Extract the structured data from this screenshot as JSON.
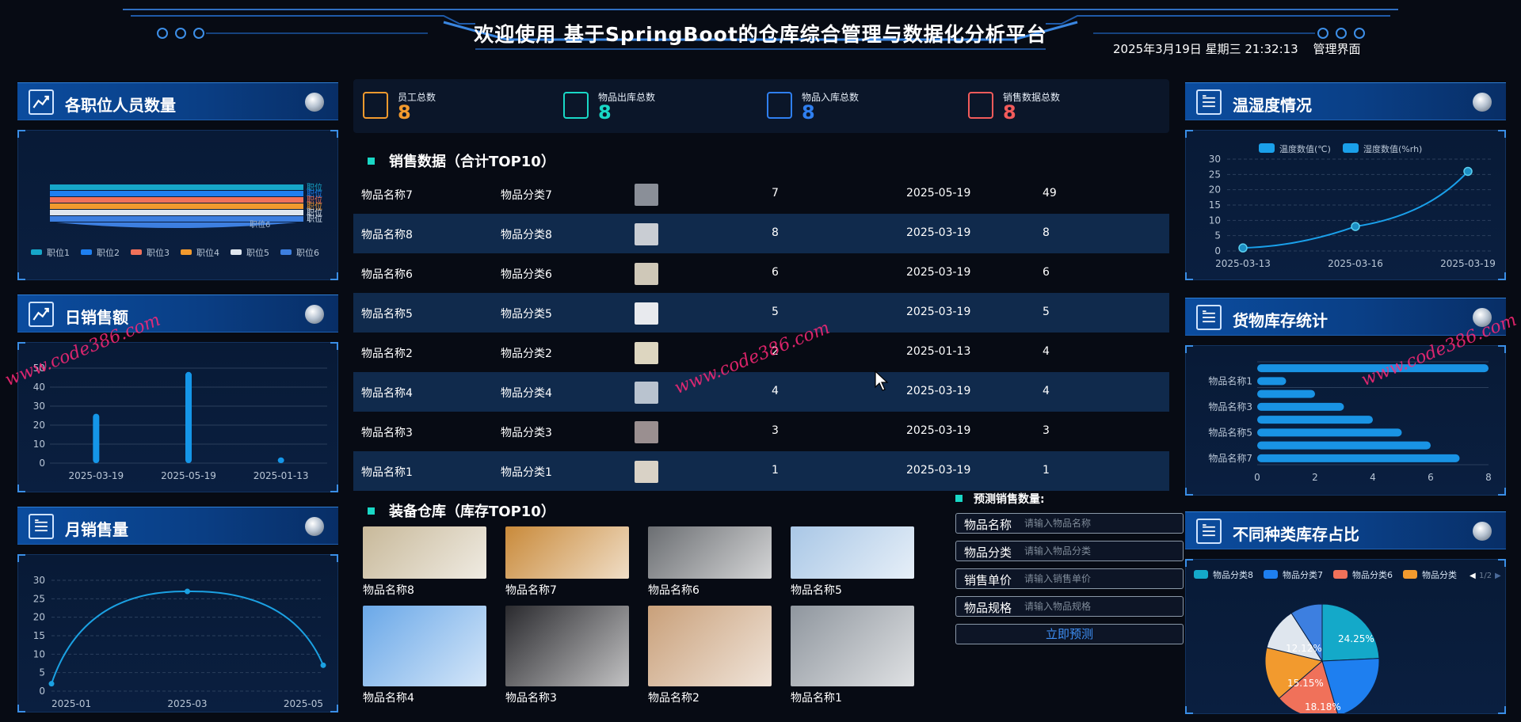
{
  "header": {
    "title": "欢迎使用 基于SpringBoot的仓库综合管理与数据化分析平台",
    "datetime": "2025年3月19日 星期三 21:32:13",
    "mode": "管理界面"
  },
  "colors": {
    "accent": "#1e8ff0",
    "teal": "#19d8c6",
    "orange": "#f29a2e",
    "red": "#f25b5b"
  },
  "left_panels": {
    "positions": {
      "title": "各职位人员数量",
      "icon": "trend-chart-icon",
      "chart_data": {
        "type": "bar",
        "orientation": "horizontal",
        "categories": [
          "职位1",
          "职位2",
          "职位3",
          "职位4",
          "职位5",
          "职位6"
        ],
        "bar_labels": [
          "职位",
          "职位",
          "职位",
          "职位",
          "职位",
          "职位"
        ],
        "bottom_label": "职位6",
        "legend": [
          "职位1",
          "职位2",
          "职位3",
          "职位4",
          "职位5",
          "职位6"
        ],
        "colors": [
          "#16a6c8",
          "#1e7ff0",
          "#f0715a",
          "#f29a2e",
          "#dfe6ee",
          "#3d7fe0"
        ]
      }
    },
    "daily_sales": {
      "title": "日销售额",
      "icon": "trend-chart-icon",
      "chart_data": {
        "type": "bar",
        "categories": [
          "2025-03-19",
          "2025-05-19",
          "2025-01-13"
        ],
        "values": [
          26,
          48,
          3
        ],
        "yticks": [
          "0",
          "10",
          "20",
          "30",
          "40",
          "50"
        ],
        "ylim": [
          0,
          50
        ]
      }
    },
    "monthly_sales": {
      "title": "月销售量",
      "icon": "document-list-icon",
      "chart_data": {
        "type": "line",
        "categories": [
          "2025-01",
          "2025-03",
          "2025-05"
        ],
        "values": [
          2,
          27,
          7
        ],
        "yticks": [
          "0",
          "5",
          "10",
          "15",
          "20",
          "25",
          "30"
        ],
        "ylim": [
          0,
          30
        ]
      }
    }
  },
  "stats": [
    {
      "label": "员工总数",
      "value": "8",
      "icon": "employee-icon",
      "color": "#f29a2e"
    },
    {
      "label": "物品出库总数",
      "value": "8",
      "icon": "people-group-icon",
      "color": "#19d8c6"
    },
    {
      "label": "物品入库总数",
      "value": "8",
      "icon": "building-icon",
      "color": "#2f7ff0"
    },
    {
      "label": "销售数据总数",
      "value": "8",
      "icon": "sales-icon",
      "color": "#f25b5b"
    }
  ],
  "sales": {
    "title": "销售数据（合计TOP10）",
    "rows": [
      {
        "name": "物品名称7",
        "category": "物品分类7",
        "price": "7",
        "date": "2025-05-19",
        "qty": "49",
        "thumb": "#8a8f98"
      },
      {
        "name": "物品名称8",
        "category": "物品分类8",
        "price": "8",
        "date": "2025-03-19",
        "qty": "8",
        "thumb": "#c9cdd3"
      },
      {
        "name": "物品名称6",
        "category": "物品分类6",
        "price": "6",
        "date": "2025-03-19",
        "qty": "6",
        "thumb": "#cfc8b8"
      },
      {
        "name": "物品名称5",
        "category": "物品分类5",
        "price": "5",
        "date": "2025-03-19",
        "qty": "5",
        "thumb": "#e8eaee"
      },
      {
        "name": "物品名称2",
        "category": "物品分类2",
        "price": "2",
        "date": "2025-01-13",
        "qty": "4",
        "thumb": "#ddd6c0"
      },
      {
        "name": "物品名称4",
        "category": "物品分类4",
        "price": "4",
        "date": "2025-03-19",
        "qty": "4",
        "thumb": "#b9c3cf"
      },
      {
        "name": "物品名称3",
        "category": "物品分类3",
        "price": "3",
        "date": "2025-03-19",
        "qty": "3",
        "thumb": "#9a8f90"
      },
      {
        "name": "物品名称1",
        "category": "物品分类1",
        "price": "1",
        "date": "2025-03-19",
        "qty": "1",
        "thumb": "#d9d2c6"
      }
    ]
  },
  "warehouse": {
    "title": "装备仓库（库存TOP10）",
    "items": [
      {
        "name": "物品名称8",
        "color": "#c8b99a"
      },
      {
        "name": "物品名称7",
        "color": "#c98a3a"
      },
      {
        "name": "物品名称6",
        "color": "#6b6e72"
      },
      {
        "name": "物品名称5",
        "color": "#a9c7e6"
      },
      {
        "name": "物品名称4",
        "color": "#6aa8e8"
      },
      {
        "name": "物品名称3",
        "color": "#2a2a2e"
      },
      {
        "name": "物品名称2",
        "color": "#c9a07a"
      },
      {
        "name": "物品名称1",
        "color": "#8f969e"
      }
    ]
  },
  "predict": {
    "title": "预测销售数量:",
    "fields": [
      {
        "label": "物品名称",
        "placeholder": "请输入物品名称"
      },
      {
        "label": "物品分类",
        "placeholder": "请输入物品分类"
      },
      {
        "label": "销售单价",
        "placeholder": "请输入销售单价"
      },
      {
        "label": "物品规格",
        "placeholder": "请输入物品规格"
      }
    ],
    "button": "立即预测"
  },
  "right_panels": {
    "climate": {
      "title": "温湿度情况",
      "icon": "document-list-icon",
      "chart_data": {
        "type": "line",
        "legend": [
          "温度数值(℃)",
          "湿度数值(%rh)"
        ],
        "categories": [
          "2025-03-13",
          "2025-03-16",
          "2025-03-19"
        ],
        "series": [
          {
            "name": "温度数值(℃)",
            "values": [
              1,
              8,
              26
            ]
          }
        ],
        "yticks": [
          "0",
          "5",
          "10",
          "15",
          "20",
          "25",
          "30"
        ],
        "ylim": [
          0,
          30
        ]
      }
    },
    "inventory": {
      "title": "货物库存统计",
      "icon": "document-list-icon",
      "chart_data": {
        "type": "bar",
        "orientation": "horizontal",
        "categories": [
          "物品名称8",
          "物品名称1",
          "物品名称2",
          "物品名称3",
          "物品名称4",
          "物品名称5",
          "物品名称6",
          "物品名称7"
        ],
        "category_labels": [
          "物品名称1",
          "物品名称3",
          "物品名称5",
          "物品名称7"
        ],
        "values": [
          8,
          1,
          2,
          3,
          4,
          5,
          6,
          7
        ],
        "xticks": [
          "0",
          "2",
          "4",
          "6",
          "8"
        ],
        "xlim": [
          0,
          8
        ]
      }
    },
    "category_share": {
      "title": "不同种类库存占比",
      "icon": "document-list-icon",
      "legend": [
        "物品分类8",
        "物品分类7",
        "物品分类6",
        "物品分类"
      ],
      "legend_page": "1/2",
      "chart_data": {
        "type": "pie",
        "labels": [
          "24.25%",
          "18.18%",
          "15.15%",
          "12.12%"
        ],
        "values": [
          24.25,
          21.21,
          18.18,
          15.15,
          12.12,
          9.09
        ],
        "colors": [
          "#14a9c9",
          "#1e7ff0",
          "#f0715a",
          "#f29a2e",
          "#dfe6ee",
          "#3d7fe0"
        ]
      }
    }
  },
  "watermark": "www.code386.com"
}
